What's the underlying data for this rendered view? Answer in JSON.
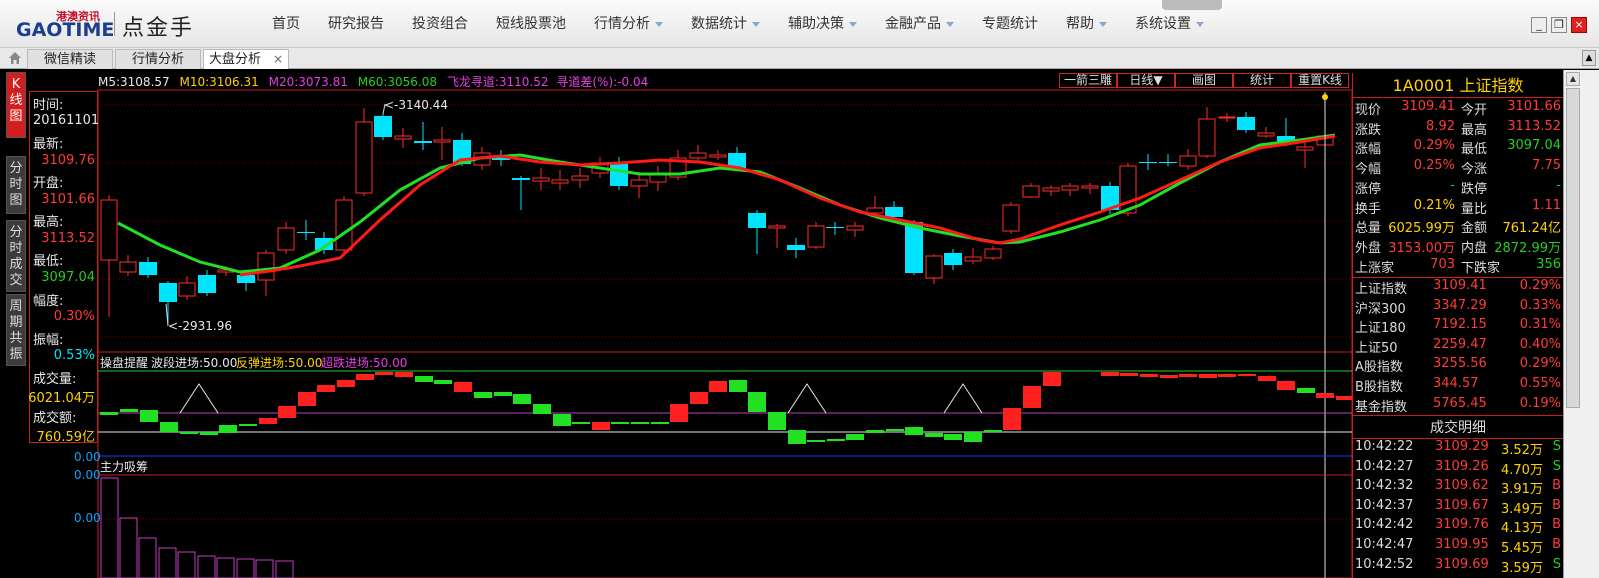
{
  "header": {
    "logo_top": "港澳资讯",
    "logo_main": "GAOTIME",
    "app_name": "点金手",
    "menu": [
      {
        "label": "首页",
        "dropdown": false
      },
      {
        "label": "研究报告",
        "dropdown": false
      },
      {
        "label": "投资组合",
        "dropdown": false
      },
      {
        "label": "短线股票池",
        "dropdown": false
      },
      {
        "label": "行情分析",
        "dropdown": true
      },
      {
        "label": "数据统计",
        "dropdown": true
      },
      {
        "label": "辅助决策",
        "dropdown": true
      },
      {
        "label": "金融产品",
        "dropdown": true
      },
      {
        "label": "专题统计",
        "dropdown": false
      },
      {
        "label": "帮助",
        "dropdown": true
      },
      {
        "label": "系统设置",
        "dropdown": true
      }
    ],
    "win_min": "_",
    "win_max": "❐",
    "win_close": "×"
  },
  "tabs": [
    {
      "label": "微信精读"
    },
    {
      "label": "行情分析"
    },
    {
      "label": "大盘分析",
      "close": "×"
    }
  ],
  "sidetabs": [
    "K线图",
    "分时图",
    "分时成交",
    "周期共振"
  ],
  "info": {
    "time_label": "时间:",
    "time_value": "20161101",
    "latest_label": "最新:",
    "latest_value": "3109.76",
    "open_label": "开盘:",
    "open_value": "3101.66",
    "high_label": "最高:",
    "high_value": "3113.52",
    "low_label": "最低:",
    "low_value": "3097.04",
    "range_label": "幅度:",
    "range_value": "0.30%",
    "amp_label": "振幅:",
    "amp_value": "0.53%",
    "vol_label": "成交量:",
    "vol_value": "6021.04万",
    "amt_label": "成交额:",
    "amt_value": "760.59亿"
  },
  "ma": {
    "m5": "M5:3108.57",
    "m10": "M10:3106.31",
    "m20": "M20:3073.81",
    "m60": "M60:3056.08",
    "fl": "飞龙寻道:3110.52",
    "diff": "寻道差(%):-0.04"
  },
  "chart_buttons": [
    "一箭三雕",
    "日线▼",
    "画图",
    "统计",
    "重置K线"
  ],
  "chart_labels": {
    "high_mark": "<-3140.44",
    "low_mark": "<-2931.96",
    "ind1_title": "操盘提醒",
    "ind1_a": "波段进场:50.00",
    "ind1_b": "反弹进场:50.00",
    "ind1_c": "超跌进场:50.00",
    "ind1_axis": "0.00",
    "ind2_title": "主力吸筹",
    "ind2_axis_top": "0.00",
    "ind2_axis_mid": "0.00"
  },
  "colors": {
    "up": "#ff2b2b",
    "down": "#00e5ff",
    "ma_red": "#ff1a1a",
    "ma_green": "#22e022",
    "grid": "#7a0000",
    "border": "#c81e1e"
  },
  "stock": {
    "code_name": "1A0001  上证指数"
  },
  "quote": [
    {
      "a": "现价",
      "b": "3109.41",
      "bc": "red",
      "c": "今开",
      "d": "3101.66",
      "dc": "red"
    },
    {
      "a": "涨跌",
      "b": "8.92",
      "bc": "red",
      "c": "最高",
      "d": "3113.52",
      "dc": "red"
    },
    {
      "a": "涨幅",
      "b": "0.29%",
      "bc": "red",
      "c": "最低",
      "d": "3097.04",
      "dc": "green"
    },
    {
      "a": "今幅",
      "b": "0.25%",
      "bc": "red",
      "c": "今涨",
      "d": "7.75",
      "dc": "red"
    },
    {
      "a": "涨停",
      "b": "-",
      "bc": "green",
      "c": "跌停",
      "d": "-",
      "dc": "green"
    },
    {
      "a": "换手",
      "b": "0.21%",
      "bc": "yellow",
      "c": "量比",
      "d": "1.11",
      "dc": "red"
    },
    {
      "a": "总量",
      "b": "6025.99万",
      "bc": "yellow",
      "c": "金额",
      "d": "761.24亿",
      "dc": "yellow"
    },
    {
      "a": "外盘",
      "b": "3153.00万",
      "bc": "red",
      "c": "内盘",
      "d": "2872.99万",
      "dc": "green"
    },
    {
      "a": "上涨家",
      "b": "703",
      "bc": "red",
      "c": "下跌家",
      "d": "356",
      "dc": "green"
    }
  ],
  "indices": [
    {
      "n": "上证指数",
      "p": "3109.41",
      "q": "0.29%"
    },
    {
      "n": "沪深300",
      "p": "3347.29",
      "q": "0.33%"
    },
    {
      "n": "上证180",
      "p": "7192.15",
      "q": "0.31%"
    },
    {
      "n": "上证50",
      "p": "2259.47",
      "q": "0.40%"
    },
    {
      "n": "A股指数",
      "p": "3255.56",
      "q": "0.29%"
    },
    {
      "n": "B股指数",
      "p": "344.57",
      "q": "0.55%"
    },
    {
      "n": "基金指数",
      "p": "5765.45",
      "q": "0.19%"
    }
  ],
  "trades_title": "成交明细",
  "trades": [
    {
      "t": "10:42:22",
      "pr": "3109.29",
      "vo": "3.52万",
      "bs": "S"
    },
    {
      "t": "10:42:27",
      "pr": "3109.26",
      "vo": "4.70万",
      "bs": "S"
    },
    {
      "t": "10:42:32",
      "pr": "3109.62",
      "vo": "3.91万",
      "bs": "B"
    },
    {
      "t": "10:42:37",
      "pr": "3109.67",
      "vo": "3.49万",
      "bs": "B"
    },
    {
      "t": "10:42:42",
      "pr": "3109.76",
      "vo": "4.13万",
      "bs": "B"
    },
    {
      "t": "10:42:47",
      "pr": "3109.95",
      "vo": "5.45万",
      "bs": "B"
    },
    {
      "t": "10:42:52",
      "pr": "3109.69",
      "vo": "3.59万",
      "bs": "S"
    }
  ]
}
